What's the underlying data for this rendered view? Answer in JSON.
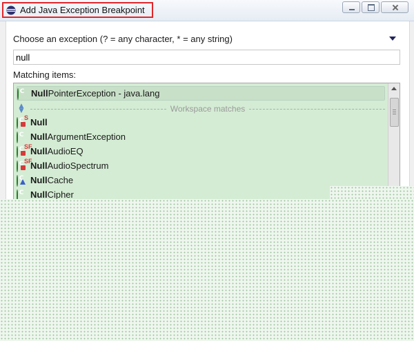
{
  "window": {
    "title": "Add Java Exception Breakpoint"
  },
  "dialog": {
    "prompt": "Choose an exception (? = any character, * = any string)",
    "search_value": "null",
    "matching_label": "Matching items:",
    "separator_label": "Workspace matches"
  },
  "items": [
    {
      "bold": "Null",
      "rest": "PointerException - java.lang",
      "icon": "class-icon",
      "selected": true
    },
    {
      "bold": "Null",
      "rest": "",
      "icon": "static-class-icon"
    },
    {
      "bold": "Null",
      "rest": "ArgumentException",
      "icon": "class-icon"
    },
    {
      "bold": "Null",
      "rest": "AudioEQ",
      "icon": "static-final-class-icon"
    },
    {
      "bold": "Null",
      "rest": "AudioSpectrum",
      "icon": "static-final-class-icon"
    },
    {
      "bold": "Null",
      "rest": "Cache",
      "icon": "abstract-class-icon"
    },
    {
      "bold": "Null",
      "rest": "Cipher",
      "icon": "class-icon"
    }
  ],
  "colors": {
    "list_background": "#d4ecd4",
    "title_highlight": "#e0262a",
    "class_icon": "#3a9a3a"
  }
}
